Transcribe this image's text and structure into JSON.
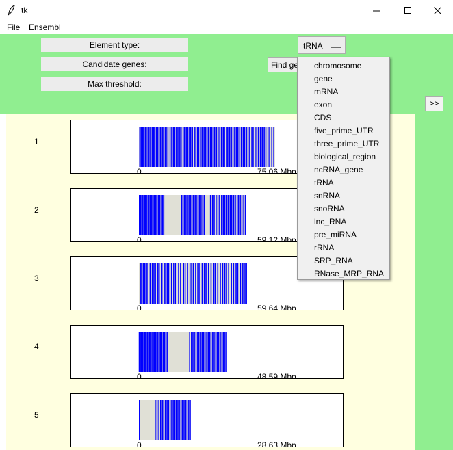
{
  "window": {
    "title": "tk",
    "minimize_icon": "minimize-icon",
    "maximize_icon": "maximize-icon",
    "close_icon": "close-icon"
  },
  "menu": {
    "items": [
      "File",
      "Ensembl"
    ]
  },
  "controls": {
    "element_type_label": "Element type:",
    "candidate_genes_label": "Candidate genes:",
    "max_threshold_label": "Max threshold:",
    "find_button_label": "Find genes",
    "selected_type": "tRNA",
    "next_button_label": ">>"
  },
  "dropdown": {
    "options": [
      "chromosome",
      "gene",
      "mRNA",
      "exon",
      "CDS",
      "five_prime_UTR",
      "three_prime_UTR",
      "biological_region",
      "ncRNA_gene",
      "tRNA",
      "snRNA",
      "snoRNA",
      "lnc_RNA",
      "pre_miRNA",
      "rRNA",
      "SRP_RNA",
      "RNase_MRP_RNA"
    ]
  },
  "chromosomes": [
    {
      "label": "1",
      "start_label": "0",
      "end_label": "75.06 Mbp",
      "length_mbp": 75.06,
      "lines_mbp": [
        0.5,
        1.2,
        2.0,
        2.6,
        3.5,
        4.1,
        5.0,
        5.6,
        6.4,
        7.3,
        8.1,
        8.7,
        9.6,
        10.4,
        11.2,
        12.0,
        12.9,
        13.6,
        14.5,
        15.1,
        16.0,
        17.2,
        18.1,
        19.0,
        19.8,
        20.7,
        21.5,
        22.6,
        23.3,
        24.4,
        25.2,
        26.1,
        27.0,
        27.9,
        28.6,
        29.5,
        30.6,
        31.4,
        32.3,
        33.0,
        33.9,
        34.8,
        35.9,
        36.7,
        37.5,
        38.3,
        39.4,
        40.2,
        41.0,
        41.8,
        42.8,
        43.7,
        44.6,
        45.5,
        46.5,
        47.2,
        48.3,
        49.0,
        50.1,
        51.0,
        51.9,
        52.8,
        53.7,
        54.6,
        55.6,
        56.5,
        57.5,
        58.3,
        59.3,
        60.2,
        61.1,
        62.3,
        63.0,
        64.1,
        65.0,
        65.9,
        67.0,
        68.0,
        69.1,
        70.0,
        71.2,
        72.1,
        73.3,
        74.4
      ]
    },
    {
      "label": "2",
      "start_label": "0",
      "end_label": "59.12 Mbp",
      "length_mbp": 59.12,
      "lines_mbp": [
        0.3,
        0.9,
        1.6,
        2.2,
        2.9,
        3.5,
        4.2,
        5.0,
        5.6,
        6.3,
        7.1,
        7.8,
        8.5,
        9.3,
        10.0,
        10.8,
        11.5,
        12.3,
        13.0,
        13.7,
        23.5,
        24.3,
        25.1,
        26.0,
        26.8,
        27.6,
        28.5,
        29.3,
        30.1,
        31.0,
        31.7,
        32.6,
        33.4,
        34.3,
        35.2,
        36.0,
        39.5,
        40.6,
        41.5,
        42.6,
        43.6,
        44.5,
        45.6,
        46.5,
        47.4,
        48.5,
        49.3,
        50.3,
        51.2,
        52.3,
        53.2,
        54.2,
        55.0,
        55.9,
        56.8,
        57.8,
        58.7
      ]
    },
    {
      "label": "3",
      "start_label": "0",
      "end_label": "59.64 Mbp",
      "length_mbp": 59.64,
      "lines_mbp": [
        0.8,
        1.5,
        2.4,
        3.3,
        4.5,
        6.2,
        7.4,
        8.3,
        9.1,
        10.5,
        11.2,
        12.7,
        14.3,
        15.6,
        16.4,
        18.0,
        19.2,
        20.1,
        21.9,
        23.0,
        24.6,
        25.5,
        26.8,
        28.2,
        29.1,
        30.0,
        31.3,
        32.5,
        33.2,
        34.9,
        36.1,
        37.0,
        38.4,
        39.8,
        41.2,
        42.0,
        43.5,
        44.9,
        46.2,
        47.4,
        48.3,
        49.5,
        51.0,
        52.2,
        53.6,
        54.5,
        56.0,
        57.3,
        58.5,
        59.3
      ]
    },
    {
      "label": "4",
      "start_label": "0",
      "end_label": "48.59 Mbp",
      "length_mbp": 48.59,
      "lines_mbp": [
        0.2,
        0.8,
        1.4,
        2.0,
        2.7,
        3.3,
        3.9,
        4.6,
        5.2,
        5.9,
        6.5,
        7.2,
        7.9,
        8.5,
        9.2,
        9.9,
        10.5,
        11.3,
        12.0,
        12.7,
        13.5,
        14.2,
        15.0,
        15.8,
        28.0,
        29.0,
        29.8,
        30.6,
        31.5,
        32.4,
        33.1,
        34.0,
        34.8,
        35.7,
        36.5,
        37.4,
        38.2,
        39.0,
        39.8,
        40.7,
        41.5,
        42.4,
        43.2,
        44.0,
        44.9,
        45.8,
        46.6,
        47.5,
        48.3
      ]
    },
    {
      "label": "5",
      "start_label": "0",
      "end_label": "28.63 Mbp",
      "length_mbp": 28.63,
      "lines_mbp": [
        0.3,
        9.0,
        10.0,
        11.0,
        12.0,
        12.9,
        13.7,
        14.6,
        15.5,
        16.3,
        17.2,
        18.1,
        18.9,
        19.8,
        20.6,
        21.5,
        22.3,
        23.2,
        24.0,
        24.9,
        25.8,
        26.6,
        27.5,
        28.3
      ]
    }
  ],
  "colors": {
    "background_green": "#90ee90",
    "panel_yellow": "#ffffe0",
    "bar_grey": "#e0e0d6",
    "gene_line_blue": "#0000ff"
  }
}
